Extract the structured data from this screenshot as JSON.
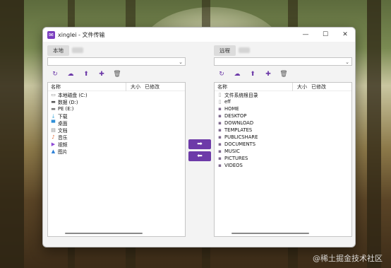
{
  "window": {
    "title": "xinglei - 文件传输",
    "controls": {
      "minimize": "—",
      "maximize": "☐",
      "close": "✕"
    }
  },
  "left": {
    "tab": "本地",
    "columns": {
      "name": "名称",
      "size": "大小",
      "modified": "已修改"
    },
    "items": [
      {
        "label": "本地磁盘 (C:)",
        "icon": "drive-icon",
        "glyph": "▭",
        "color": "#7a7a7a"
      },
      {
        "label": "数据 (D:)",
        "icon": "drive-icon",
        "glyph": "▬",
        "color": "#555555"
      },
      {
        "label": "PE (E:)",
        "icon": "drive-icon",
        "glyph": "▬",
        "color": "#777777"
      },
      {
        "label": "下载",
        "icon": "download-icon",
        "glyph": "⤓",
        "color": "#1c9ad6"
      },
      {
        "label": "桌面",
        "icon": "desktop-icon",
        "glyph": "▀",
        "color": "#2f8fd8"
      },
      {
        "label": "文档",
        "icon": "document-icon",
        "glyph": "▤",
        "color": "#8a8a8a"
      },
      {
        "label": "音乐",
        "icon": "music-icon",
        "glyph": "♪",
        "color": "#e0632d"
      },
      {
        "label": "视频",
        "icon": "video-icon",
        "glyph": "▶",
        "color": "#8f4ad6"
      },
      {
        "label": "图片",
        "icon": "picture-icon",
        "glyph": "▲",
        "color": "#2b7fd6"
      }
    ]
  },
  "right": {
    "tab": "远程",
    "columns": {
      "name": "名称",
      "size": "大小",
      "modified": "已修改"
    },
    "items": [
      {
        "label": "文件系统根目录",
        "icon": "root-icon",
        "glyph": "▯",
        "color": "#9a9a9a"
      },
      {
        "label": "eff",
        "icon": "file-icon",
        "glyph": "▯",
        "color": "#9a9a9a"
      },
      {
        "label": "HOME",
        "icon": "folder-icon",
        "glyph": "▪",
        "color": "#7f6b8f"
      },
      {
        "label": "DESKTOP",
        "icon": "folder-icon",
        "glyph": "▪",
        "color": "#7f6b8f"
      },
      {
        "label": "DOWNLOAD",
        "icon": "folder-icon",
        "glyph": "▪",
        "color": "#7f6b8f"
      },
      {
        "label": "TEMPLATES",
        "icon": "folder-icon",
        "glyph": "▪",
        "color": "#7f6b8f"
      },
      {
        "label": "PUBLICSHARE",
        "icon": "folder-icon",
        "glyph": "▪",
        "color": "#7f6b8f"
      },
      {
        "label": "DOCUMENTS",
        "icon": "folder-icon",
        "glyph": "▪",
        "color": "#7f6b8f"
      },
      {
        "label": "MUSIC",
        "icon": "folder-icon",
        "glyph": "▪",
        "color": "#7f6b8f"
      },
      {
        "label": "PICTURES",
        "icon": "folder-icon",
        "glyph": "▪",
        "color": "#7f6b8f"
      },
      {
        "label": "VIDEOS",
        "icon": "folder-icon",
        "glyph": "▪",
        "color": "#7f6b8f"
      }
    ]
  },
  "toolbar_icons": [
    {
      "name": "refresh-icon",
      "glyph": "↻"
    },
    {
      "name": "cloud-download-icon",
      "glyph": "☁"
    },
    {
      "name": "folder-up-icon",
      "glyph": "⬆"
    },
    {
      "name": "new-folder-icon",
      "glyph": "✚"
    },
    {
      "name": "delete-icon",
      "glyph": "🗑"
    }
  ],
  "transfer": {
    "upload": "➡",
    "download": "⬅"
  },
  "accent": "#6d3aa8",
  "watermark": "@稀土掘金技术社区"
}
